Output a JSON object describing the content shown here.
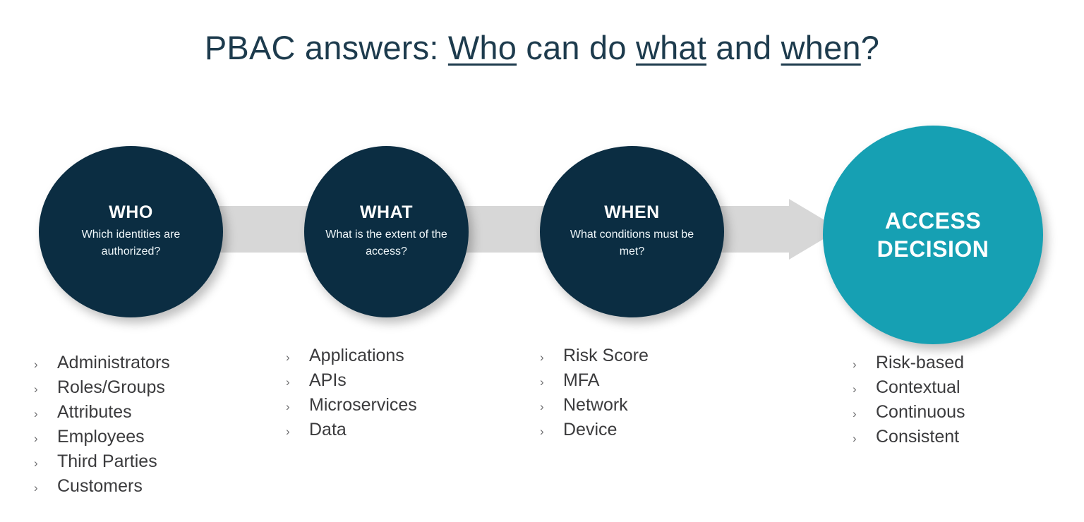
{
  "title": {
    "prefix": "PBAC answers: ",
    "underline_1": "Who",
    "mid_1": " can do ",
    "underline_2": "what",
    "mid_2": " and ",
    "underline_3": "when",
    "suffix": "?"
  },
  "colors": {
    "dark_navy": "#0b2d42",
    "accent_teal": "#16a0b3",
    "connector_gray": "#d7d7d7",
    "title_text": "#1d3b4d",
    "body_text": "#3b3b3d"
  },
  "nodes": [
    {
      "id": "who",
      "heading": "WHO",
      "subtext": "Which identities are authorized?",
      "style": "dark"
    },
    {
      "id": "what",
      "heading": "WHAT",
      "subtext": "What is the extent of the access?",
      "style": "dark"
    },
    {
      "id": "when",
      "heading": "WHEN",
      "subtext": "What conditions must be met?",
      "style": "dark"
    },
    {
      "id": "access",
      "heading": "ACCESS DECISION",
      "heading_line_1": "ACCESS",
      "heading_line_2": "DECISION",
      "subtext": "",
      "style": "accent"
    }
  ],
  "bullet_marker": "›",
  "lists": {
    "who": [
      "Administrators",
      "Roles/Groups",
      "Attributes",
      "Employees",
      "Third Parties",
      "Customers"
    ],
    "what": [
      "Applications",
      "APIs",
      "Microservices",
      "Data"
    ],
    "when": [
      "Risk Score",
      "MFA",
      "Network",
      "Device"
    ],
    "access": [
      "Risk-based",
      "Contextual",
      "Continuous",
      "Consistent"
    ]
  }
}
